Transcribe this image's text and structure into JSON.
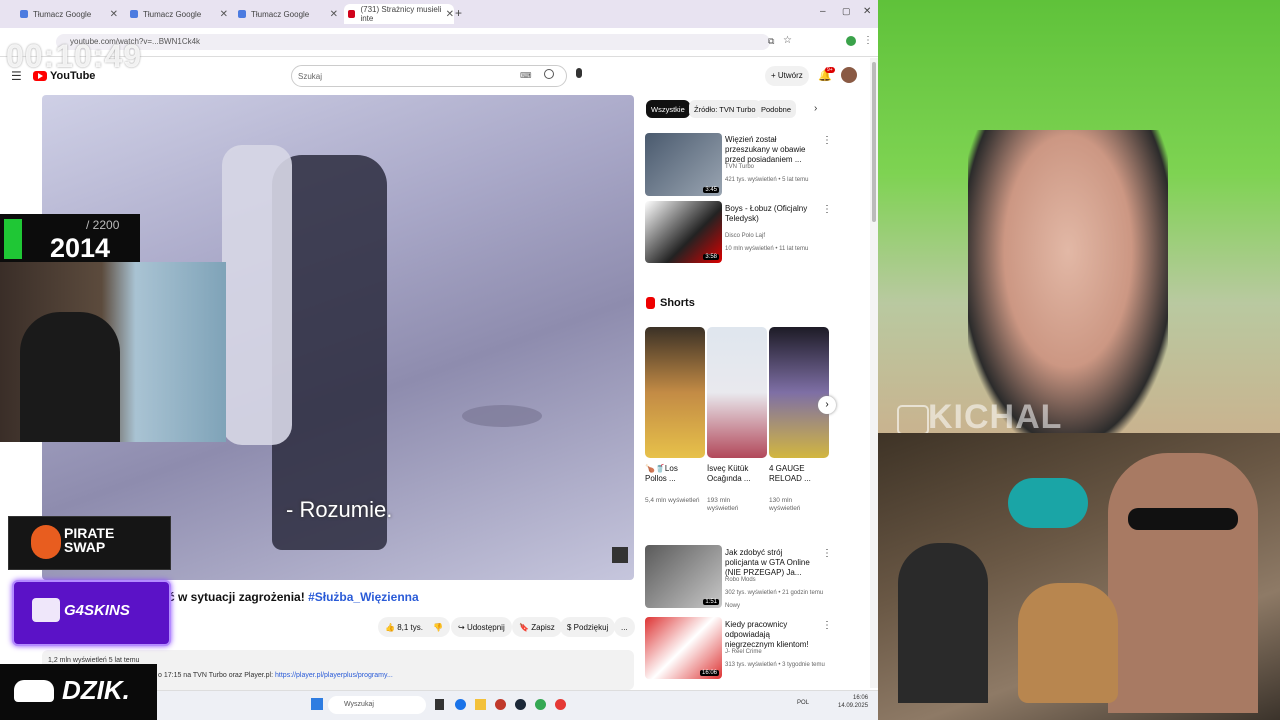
{
  "browser": {
    "tabs": [
      {
        "label": "Tłumacz Google"
      },
      {
        "label": "Tłumacz Google"
      },
      {
        "label": "Tłumacz Google"
      },
      {
        "label": "(731) Strażnicy musieli inte"
      }
    ],
    "url": "youtube.com/watch?v=...BWN1Ck4k"
  },
  "youtube": {
    "logo": "YouTube",
    "search_placeholder": "Szukaj",
    "create_label": "Utwórz",
    "notif_count": "9+",
    "subtitle": "- Rozumie.",
    "video_title_prefix": "ć w sytuacji zagrożenia!",
    "video_title_tag": "#Służba_Więzienna",
    "actions": {
      "likes": "8,1 tys.",
      "share": "Udostępnij",
      "save": "Zapisz",
      "thanks": "Podziękuj",
      "more": "..."
    },
    "description": {
      "views": "1,2 mln wyświetleń  5 lat temu",
      "text": "o 17:15 na TVN Turbo oraz Player.pl:",
      "link": "https://player.pl/playerplus/programy..."
    },
    "chips": [
      "Wszystkie",
      "Źródło: TVN Turbo",
      "Podobne"
    ],
    "recommended": [
      {
        "title": "Więzień został przeszukany w obawie przed posiadaniem ...",
        "channel": "TVN Turbo",
        "meta": "421 tys. wyświetleń • 5 lat temu",
        "duration": "3:45"
      },
      {
        "title": "Boys - Łobuz (Oficjalny Teledysk)",
        "channel": "Disco Polo Lajf",
        "meta": "10 mln wyświetleń • 11 lat temu",
        "duration": "3:58"
      }
    ],
    "shorts_heading": "Shorts",
    "shorts": [
      {
        "title": "🍗🥤Los Pollos ...",
        "views": "5,4 mln wyświetleń"
      },
      {
        "title": "İsveç Kütük Ocağında ...",
        "views": "193 mln wyświetleń"
      },
      {
        "title": "4 GAUGE RELOAD ...",
        "views": "130 mln wyświetleń"
      }
    ],
    "recommended_more": [
      {
        "title": "Jak zdobyć strój policjanta w GTA Online (NIE PRZEGAP) Ja...",
        "channel": "Robo Mods",
        "meta": "302 tys. wyświetleń • 21 godzin temu",
        "badge": "Nowy",
        "duration": "1:51"
      },
      {
        "title": "Kiedy pracownicy odpowiadają niegrzecznym klientom!",
        "channel": "J- Reel Crime",
        "meta": "313 tys. wyświetleń • 3 tygodnie temu",
        "duration": "16:06"
      }
    ]
  },
  "taskbar": {
    "search_placeholder": "Wyszukaj",
    "lang": "POL",
    "time": "16:06",
    "date": "14.09.2025"
  },
  "overlays": {
    "timer": "00:10:49",
    "elo_max": "/ 2200",
    "elo_value": "2014",
    "pirate": "PIRATE\nSWAP",
    "g4": "G4SKINS",
    "dzik": "DZIK.",
    "cam_name": "KICHAL"
  }
}
